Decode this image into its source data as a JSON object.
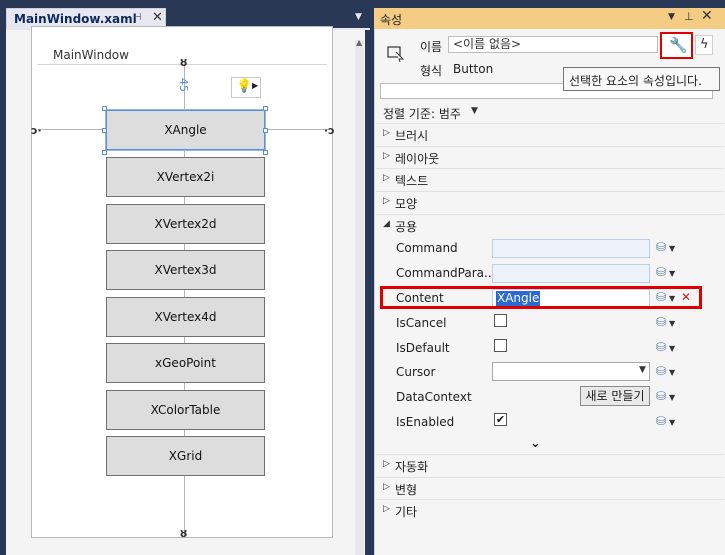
{
  "document_tab": {
    "title": "MainWindow.xaml",
    "pin_icon": "pin-icon",
    "close_icon": "close-icon"
  },
  "designer": {
    "window_title": "MainWindow",
    "margin_value": "45",
    "buttons": [
      {
        "label": "XAngle",
        "selected": true
      },
      {
        "label": "XVertex2i",
        "selected": false
      },
      {
        "label": "XVertex2d",
        "selected": false
      },
      {
        "label": "XVertex3d",
        "selected": false
      },
      {
        "label": "XVertex4d",
        "selected": false
      },
      {
        "label": "xGeoPoint",
        "selected": false
      },
      {
        "label": "XColorTable",
        "selected": false
      },
      {
        "label": "XGrid",
        "selected": false
      }
    ]
  },
  "properties": {
    "title": "속성",
    "name_label": "이름",
    "name_value": "<이름 없음>",
    "type_label": "형식",
    "type_value": "Button",
    "tooltip": "선택한 요소의 속성입니다.",
    "arrange_by": "정렬 기준: 범주",
    "categories_top": [
      "브러시",
      "레이아웃",
      "텍스트",
      "모양"
    ],
    "common_category": "공용",
    "common_props": {
      "command": "Command",
      "command_param": "CommandPara...",
      "content": "Content",
      "content_value": "XAngle",
      "is_cancel": "IsCancel",
      "is_cancel_checked": false,
      "is_default": "IsDefault",
      "is_default_checked": false,
      "cursor": "Cursor",
      "data_context": "DataContext",
      "new_button": "새로 만들기",
      "is_enabled": "IsEnabled",
      "is_enabled_checked": true
    },
    "categories_bottom": [
      "자동화",
      "변형",
      "기타"
    ]
  },
  "colors": {
    "accent_highlight": "#e00000",
    "selection": "#2a6ad2",
    "header": "#f5cc84",
    "background": "#293955"
  }
}
